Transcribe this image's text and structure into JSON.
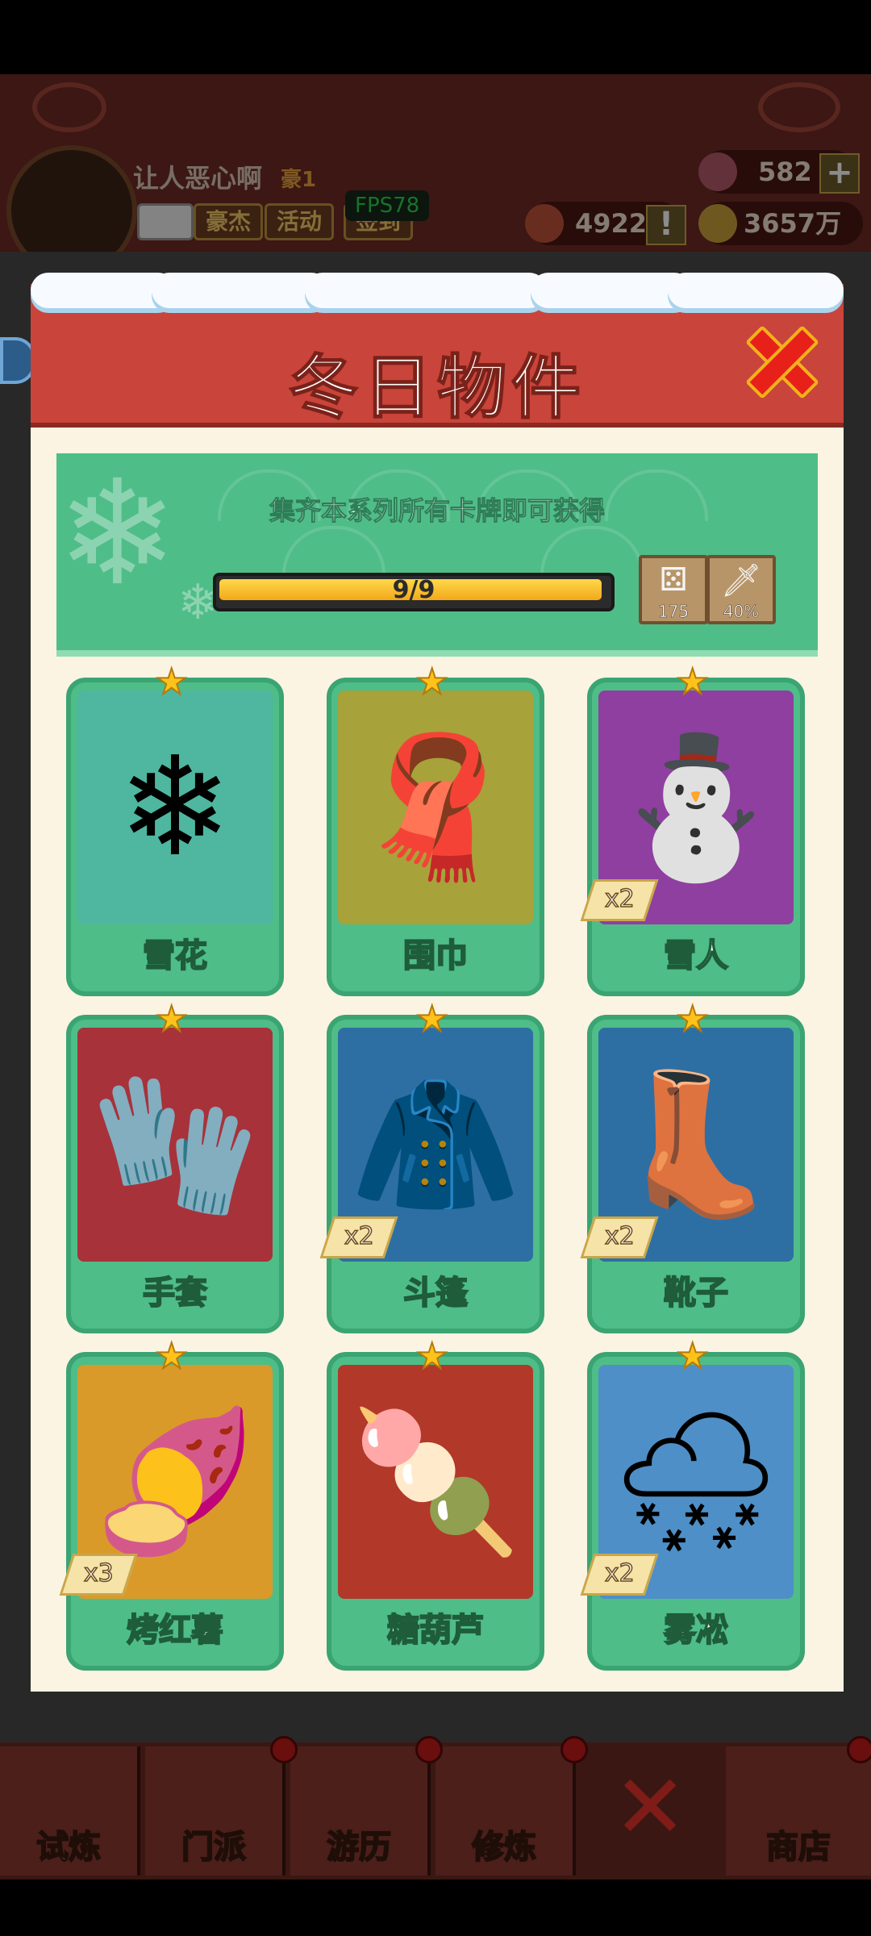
{
  "hud": {
    "username": "让人恶心啊",
    "rank_badge": "豪1",
    "chip_buttons": [
      "豪杰",
      "活动",
      "签到"
    ],
    "fps": "FPS78",
    "gems": "582",
    "tokens": "4922",
    "coins": "3657万"
  },
  "modal": {
    "title": "冬日物件",
    "banner": {
      "text": "集齐本系列所有卡牌即可获得",
      "progress_label": "9/9",
      "progress_fraction": 1.0,
      "rewards": [
        {
          "icon": "dice-icon",
          "value": "175"
        },
        {
          "icon": "sword-icon",
          "value": "40%"
        }
      ]
    },
    "cards": [
      {
        "name": "雪花",
        "count": "",
        "bg": "#4fb6a0",
        "glyph": "❄"
      },
      {
        "name": "围巾",
        "count": "",
        "bg": "#a7a23a",
        "glyph": "🧣"
      },
      {
        "name": "雪人",
        "count": "x2",
        "bg": "#8e3fa0",
        "glyph": "⛄"
      },
      {
        "name": "手套",
        "count": "",
        "bg": "#a8323a",
        "glyph": "🧤"
      },
      {
        "name": "斗篷",
        "count": "x2",
        "bg": "#2e6fa3",
        "glyph": "🧥"
      },
      {
        "name": "靴子",
        "count": "x2",
        "bg": "#2e6fa3",
        "glyph": "👢"
      },
      {
        "name": "烤红薯",
        "count": "x3",
        "bg": "#d99a2a",
        "glyph": "🍠"
      },
      {
        "name": "糖葫芦",
        "count": "",
        "bg": "#b2382a",
        "glyph": "🍡"
      },
      {
        "name": "雾凇",
        "count": "x2",
        "bg": "#4f8fc7",
        "glyph": "🌨"
      }
    ]
  },
  "nav": {
    "items": [
      "试炼",
      "门派",
      "游历",
      "修炼",
      "",
      "商店"
    ]
  },
  "colors": {
    "header_red": "#c9443a",
    "card_green": "#4fbd88",
    "progress_gold": "#f2a81a"
  }
}
